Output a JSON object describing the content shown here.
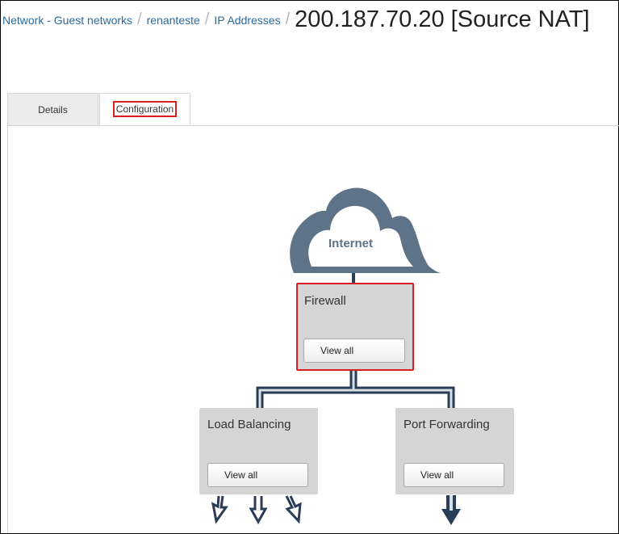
{
  "breadcrumb": {
    "items": [
      "Network - Guest networks",
      "renanteste",
      "IP Addresses"
    ],
    "separator": "/",
    "title": "200.187.70.20 [Source NAT]"
  },
  "tabs": [
    {
      "label": "Details",
      "active": false
    },
    {
      "label": "Configuration",
      "active": true
    }
  ],
  "diagram": {
    "cloud_label": "Internet",
    "firewall": {
      "title": "Firewall",
      "button": "View all"
    },
    "load_balancing": {
      "title": "Load Balancing",
      "button": "View all"
    },
    "port_forwarding": {
      "title": "Port Forwarding",
      "button": "View all"
    }
  },
  "colors": {
    "link": "#2a6aa0",
    "cloud": "#5e7288",
    "pipe": "#2a3d57",
    "highlight": "#d81e1e",
    "box": "#d5d5d5"
  }
}
